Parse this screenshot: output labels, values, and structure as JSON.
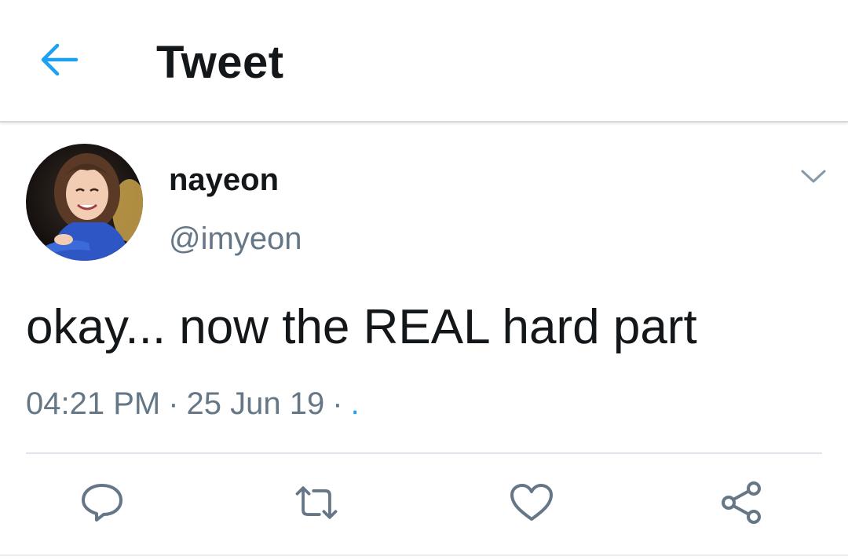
{
  "header": {
    "title": "Tweet",
    "back_icon": "arrow-left-icon"
  },
  "colors": {
    "accent": "#1da1f2",
    "text_primary": "#14171a",
    "text_secondary": "#657786",
    "divider": "#dfe5ea"
  },
  "tweet": {
    "author": {
      "display_name": "nayeon",
      "handle": "@imyeon",
      "avatar_icon": "profile-photo"
    },
    "menu_icon": "chevron-down-icon",
    "text": "okay... now the REAL hard part",
    "time": "04:21 PM",
    "date": "25 Jun 19",
    "separator": "·",
    "source": "."
  },
  "actions": [
    {
      "name": "reply",
      "icon": "speech-bubble-icon"
    },
    {
      "name": "retweet",
      "icon": "retweet-icon"
    },
    {
      "name": "like",
      "icon": "heart-icon"
    },
    {
      "name": "share",
      "icon": "share-icon"
    }
  ]
}
